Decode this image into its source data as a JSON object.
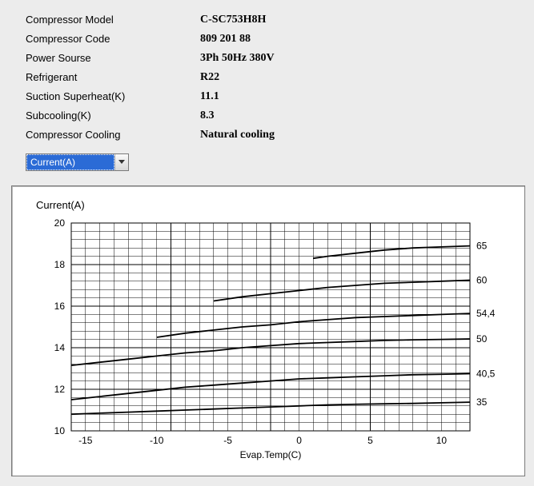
{
  "specs": {
    "rows": [
      {
        "label": "Compressor Model",
        "value": "C-SC753H8H"
      },
      {
        "label": "Compressor Code",
        "value": "809 201 88"
      },
      {
        "label": "Power Sourse",
        "value": "3Ph  50Hz  380V"
      },
      {
        "label": "Refrigerant",
        "value": "R22"
      },
      {
        "label": "Suction Superheat(K)",
        "value": "11.1"
      },
      {
        "label": "Subcooling(K)",
        "value": "8.3"
      },
      {
        "label": "Compressor Cooling",
        "value": "Natural cooling"
      }
    ]
  },
  "dropdown": {
    "selected": "Current(A)"
  },
  "chart_data": {
    "type": "line",
    "title": "Current(A)",
    "xlabel": "Evap.Temp(C)",
    "ylabel": "",
    "xlim": [
      -16,
      12
    ],
    "ylim": [
      10,
      20
    ],
    "xticks": [
      -15,
      -10,
      -5,
      0,
      5,
      10
    ],
    "yticks": [
      10,
      12,
      14,
      16,
      18,
      20
    ],
    "series": [
      {
        "name": "65",
        "x": [
          1,
          2,
          4,
          6,
          8,
          10,
          12
        ],
        "y": [
          18.3,
          18.4,
          18.55,
          18.7,
          18.8,
          18.85,
          18.9
        ]
      },
      {
        "name": "60",
        "x": [
          -6,
          -4,
          -2,
          0,
          2,
          4,
          6,
          8,
          10,
          12
        ],
        "y": [
          16.25,
          16.45,
          16.6,
          16.75,
          16.9,
          17.0,
          17.1,
          17.15,
          17.2,
          17.25
        ]
      },
      {
        "name": "54,4",
        "x": [
          -10,
          -8,
          -6,
          -4,
          -2,
          0,
          2,
          4,
          6,
          8,
          10,
          12
        ],
        "y": [
          14.5,
          14.7,
          14.85,
          15.0,
          15.1,
          15.25,
          15.35,
          15.45,
          15.5,
          15.55,
          15.6,
          15.65
        ]
      },
      {
        "name": "50",
        "x": [
          -16,
          -14,
          -12,
          -10,
          -8,
          -6,
          -4,
          -2,
          0,
          2,
          4,
          6,
          8,
          10,
          12
        ],
        "y": [
          13.15,
          13.3,
          13.45,
          13.6,
          13.75,
          13.85,
          14.0,
          14.1,
          14.2,
          14.25,
          14.3,
          14.35,
          14.38,
          14.4,
          14.42
        ]
      },
      {
        "name": "40,5",
        "x": [
          -16,
          -14,
          -12,
          -10,
          -8,
          -6,
          -4,
          -2,
          0,
          2,
          4,
          6,
          8,
          10,
          12
        ],
        "y": [
          11.5,
          11.65,
          11.8,
          11.95,
          12.1,
          12.2,
          12.3,
          12.4,
          12.5,
          12.55,
          12.6,
          12.65,
          12.7,
          12.72,
          12.75
        ]
      },
      {
        "name": "35",
        "x": [
          -16,
          -14,
          -12,
          -10,
          -8,
          -6,
          -4,
          -2,
          0,
          2,
          4,
          6,
          8,
          10,
          12
        ],
        "y": [
          10.8,
          10.85,
          10.9,
          10.95,
          11.0,
          11.05,
          11.1,
          11.15,
          11.2,
          11.25,
          11.28,
          11.3,
          11.32,
          11.35,
          11.38
        ]
      }
    ]
  }
}
